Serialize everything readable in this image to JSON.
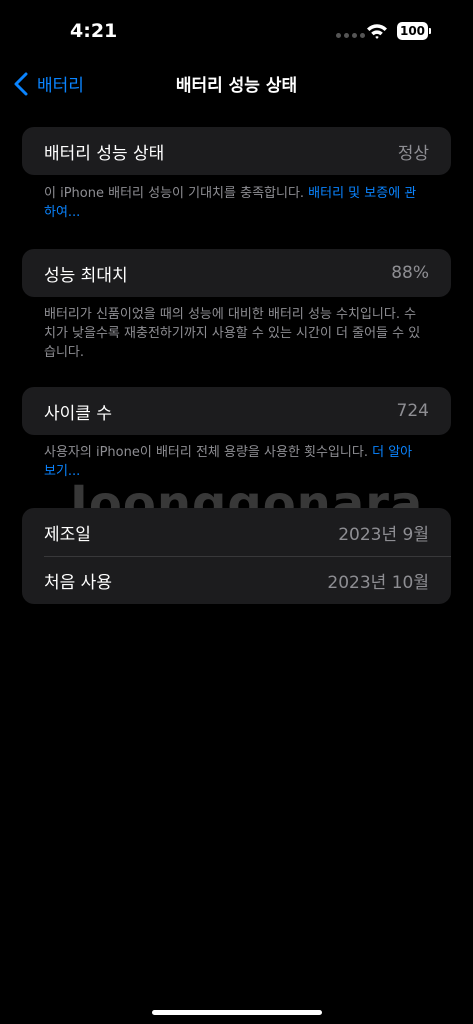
{
  "status": {
    "time": "4:21",
    "battery_level": "100",
    "icons": [
      "cellular-dots-icon",
      "wifi-icon",
      "battery-icon"
    ]
  },
  "nav": {
    "back_label": "배터리",
    "title": "배터리 성능 상태"
  },
  "sections": {
    "health": {
      "label": "배터리 성능 상태",
      "value": "정상",
      "footer": "이 iPhone 배터리 성능이 기대치를 충족합니다. ",
      "footer_link": "배터리 및 보증에 관하여..."
    },
    "max_capacity": {
      "label": "성능 최대치",
      "value": "88%",
      "footer": "배터리가 신품이었을 때의 성능에 대비한 배터리 성능 수치입니다. 수치가 낮을수록 재충전하기까지 사용할 수 있는 시간이 더 줄어들 수 있습니다."
    },
    "cycle_count": {
      "label": "사이클 수",
      "value": "724",
      "footer": "사용자의 iPhone이 배터리 전체 용량을 사용한 횟수입니다. ",
      "footer_link": "더 알아보기..."
    },
    "dates": {
      "manufacture_label": "제조일",
      "manufacture_value": "2023년 9월",
      "first_use_label": "처음 사용",
      "first_use_value": "2023년 10월"
    }
  },
  "watermark": "Joonggonara",
  "colors": {
    "background": "#000000",
    "cell": "#1c1c1e",
    "accent": "#0a84ff",
    "secondary_text": "#8e8e93"
  }
}
